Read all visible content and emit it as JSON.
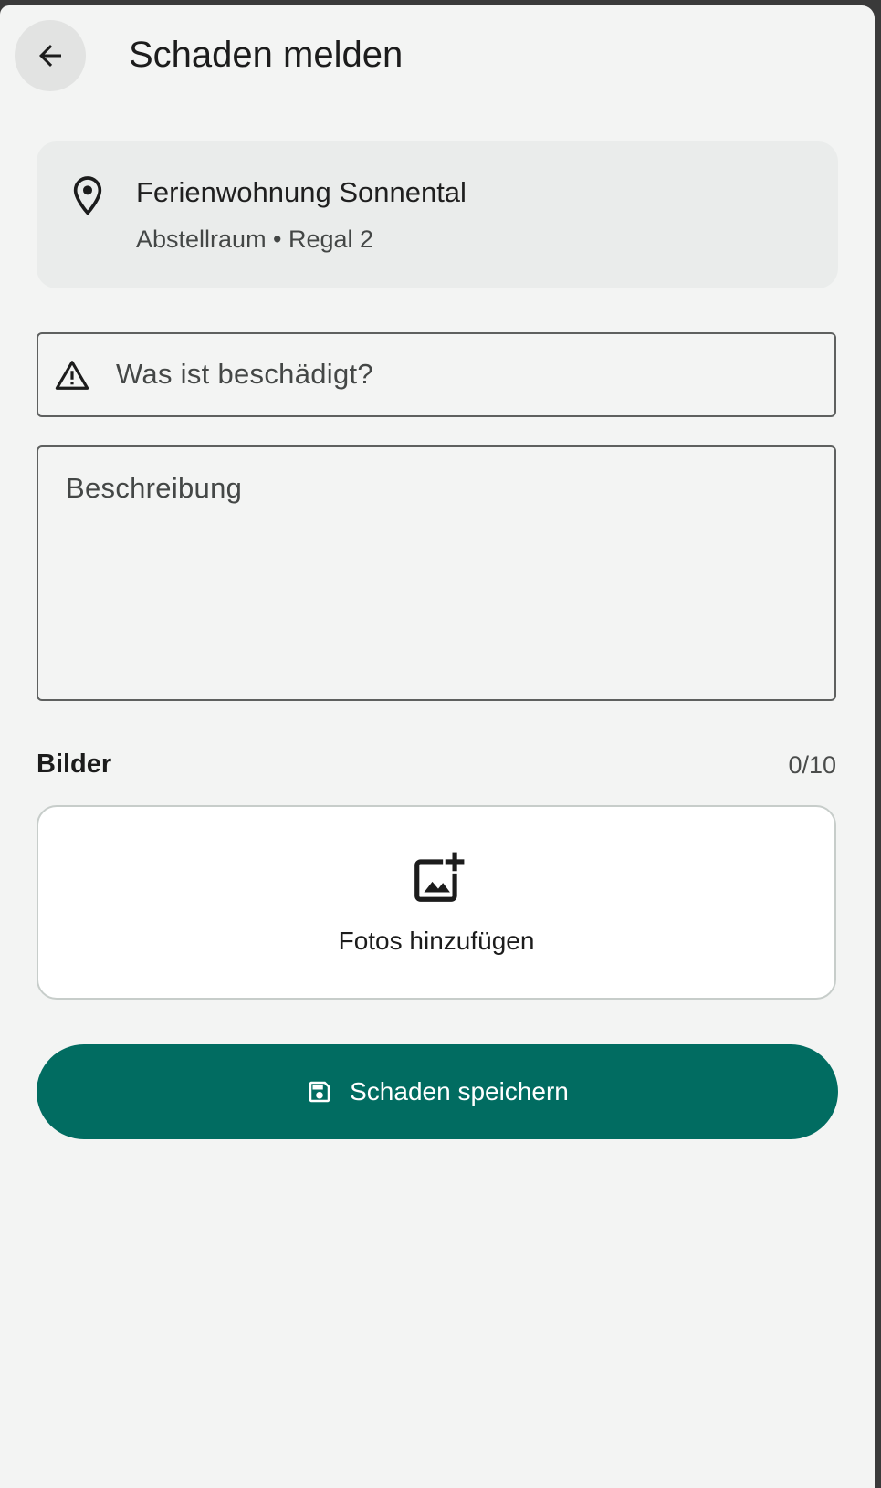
{
  "header": {
    "title": "Schaden melden",
    "back_icon": "arrow-left-icon"
  },
  "location": {
    "icon": "map-pin-icon",
    "name": "Ferienwohnung Sonnental",
    "sub": "Abstellraum • Regal 2"
  },
  "form": {
    "what_icon": "warning-triangle-icon",
    "what_placeholder": "Was ist beschädigt?",
    "what_value": "",
    "description_placeholder": "Beschreibung",
    "description_value": ""
  },
  "images": {
    "label": "Bilder",
    "count": "0/10",
    "add_icon": "add-photo-icon",
    "add_label": "Fotos hinzufügen"
  },
  "actions": {
    "save_icon": "save-icon",
    "save_label": "Schaden speichern"
  },
  "colors": {
    "primary": "#016c61",
    "background": "#f3f4f3",
    "card": "#eaeceb"
  }
}
